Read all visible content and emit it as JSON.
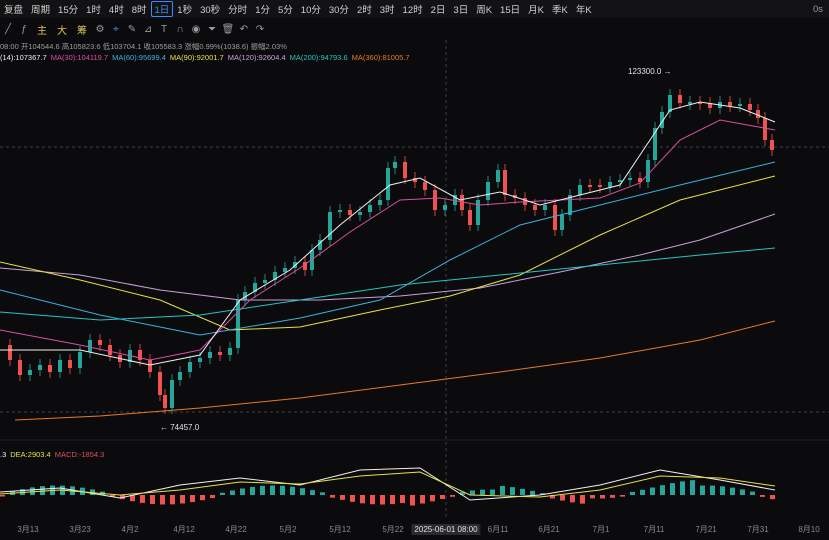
{
  "toolbar": {
    "items": [
      "复盘",
      "周期",
      "15分",
      "1时",
      "4时",
      "8时",
      "1日",
      "1秒",
      "30秒",
      "分时",
      "1分",
      "5分",
      "10分",
      "30分",
      "2时",
      "3时",
      "12时",
      "2日",
      "3日",
      "周K",
      "15日",
      "月K",
      "季K",
      "年K"
    ],
    "active_index": 6,
    "right": [
      "0s"
    ]
  },
  "drawing_bar": {
    "labels": [
      "主",
      "大",
      "筹"
    ],
    "icons": [
      "crosshair-icon",
      "pencil-icon",
      "ruler-icon",
      "text-icon",
      "magnet-icon",
      "eye-icon",
      "filter-icon",
      "trash-icon",
      "undo-icon",
      "redo-icon"
    ]
  },
  "ohlc_text": "08:00 开104544.6 高105823.6 低103704.1 收105583.3 涨幅0.99%(1038.6) 振幅2.03%",
  "ma_legend": [
    {
      "text": "(14):107367.7",
      "color": "#f1f1f1"
    },
    {
      "text": "MA(30):104119.7",
      "color": "#d94fa0"
    },
    {
      "text": "MA(60):95699.4",
      "color": "#3fb0e0"
    },
    {
      "text": "MA(90):92001.7",
      "color": "#e8e04a"
    },
    {
      "text": "MA(120):92604.4",
      "color": "#c9a0dc"
    },
    {
      "text": "MA(200):94793.6",
      "color": "#24c6c6"
    },
    {
      "text": "MA(360):81005.7",
      "color": "#e8792a"
    }
  ],
  "macd_legend": [
    {
      "text": ".3",
      "color": "#f1f1f1"
    },
    {
      "text": "DEA:2903.4",
      "color": "#e8e04a"
    },
    {
      "text": "MACD:-1854.3",
      "color": "#e0505a"
    }
  ],
  "annotations": {
    "high": "123300.0",
    "low": "74457.0"
  },
  "xaxis": {
    "labels": [
      "3月13",
      "3月23",
      "4月2",
      "4月12",
      "4月22",
      "5月2",
      "5月12",
      "5月22",
      "2025-06-01 08:00",
      "6月11",
      "6月21",
      "7月1",
      "7月11",
      "7月21",
      "7月31",
      "8月10"
    ],
    "highlight_index": 8
  },
  "colors": {
    "up": "#26a69a",
    "down": "#ef5350"
  }
}
